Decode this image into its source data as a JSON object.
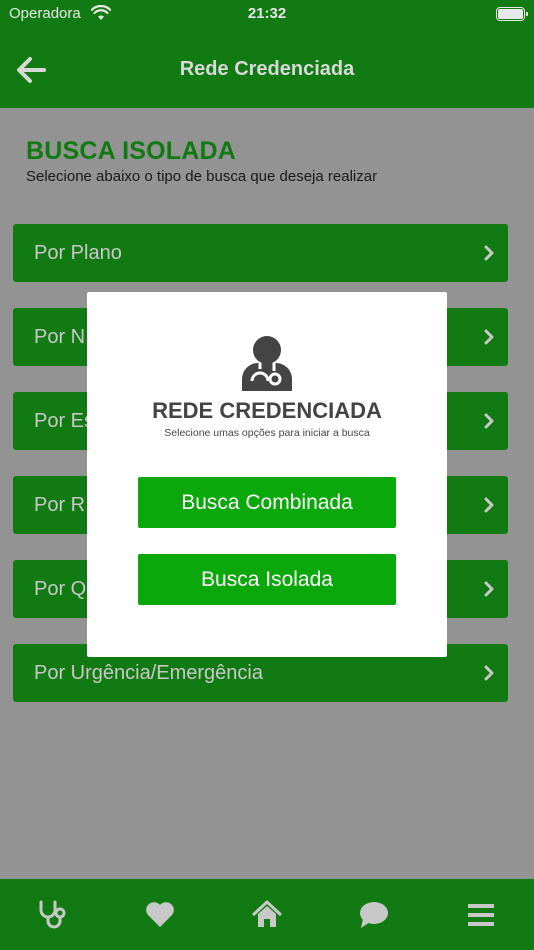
{
  "status_bar": {
    "carrier": "Operadora",
    "time": "21:32"
  },
  "header": {
    "title": "Rede Credenciada"
  },
  "main": {
    "heading": "BUSCA ISOLADA",
    "subheading": "Selecione abaixo o tipo de busca que deseja realizar",
    "rows": [
      {
        "label": "Por Plano"
      },
      {
        "label": "Por N"
      },
      {
        "label": "Por Es"
      },
      {
        "label": "Por R"
      },
      {
        "label": "Por Q"
      },
      {
        "label": "Por Urgência/Emergência"
      }
    ]
  },
  "modal": {
    "icon": "doctor-icon",
    "title": "REDE CREDENCIADA",
    "subtitle": "Selecione umas opções para iniciar a busca",
    "buttons": [
      {
        "label": "Busca Combinada"
      },
      {
        "label": "Busca Isolada"
      }
    ]
  },
  "tabbar": {
    "icons": [
      "stethoscope-icon",
      "heart-icon",
      "home-icon",
      "chat-icon",
      "menu-icon"
    ]
  },
  "colors": {
    "primary_green": "#009900",
    "button_green": "#0aa80a",
    "dimmed_green": "#127a12",
    "overlay": "#939393"
  }
}
